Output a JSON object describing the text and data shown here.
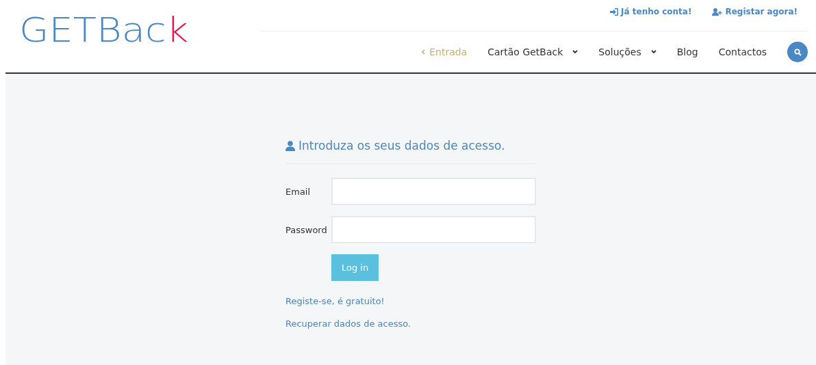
{
  "logo": {
    "text": "GETBac",
    "accent": "k"
  },
  "top_links": [
    {
      "label": "Já tenho conta!",
      "kind": "login"
    },
    {
      "label": "Registar agora!",
      "kind": "register"
    }
  ],
  "nav": [
    {
      "label": "Entrada",
      "selected": true,
      "dropdown": false
    },
    {
      "label": "Cartão GetBack",
      "selected": false,
      "dropdown": true
    },
    {
      "label": "Soluções",
      "selected": false,
      "dropdown": true
    },
    {
      "label": "Blog",
      "selected": false,
      "dropdown": false
    },
    {
      "label": "Contactos",
      "selected": false,
      "dropdown": false
    }
  ],
  "form": {
    "title": "Introduza os seus dados de acesso.",
    "fields": [
      {
        "label": "Email"
      },
      {
        "label": "Password"
      }
    ],
    "submit": "Log in",
    "links": [
      "Registe-se, é gratuito!",
      "Recuperar dados de acesso."
    ]
  }
}
